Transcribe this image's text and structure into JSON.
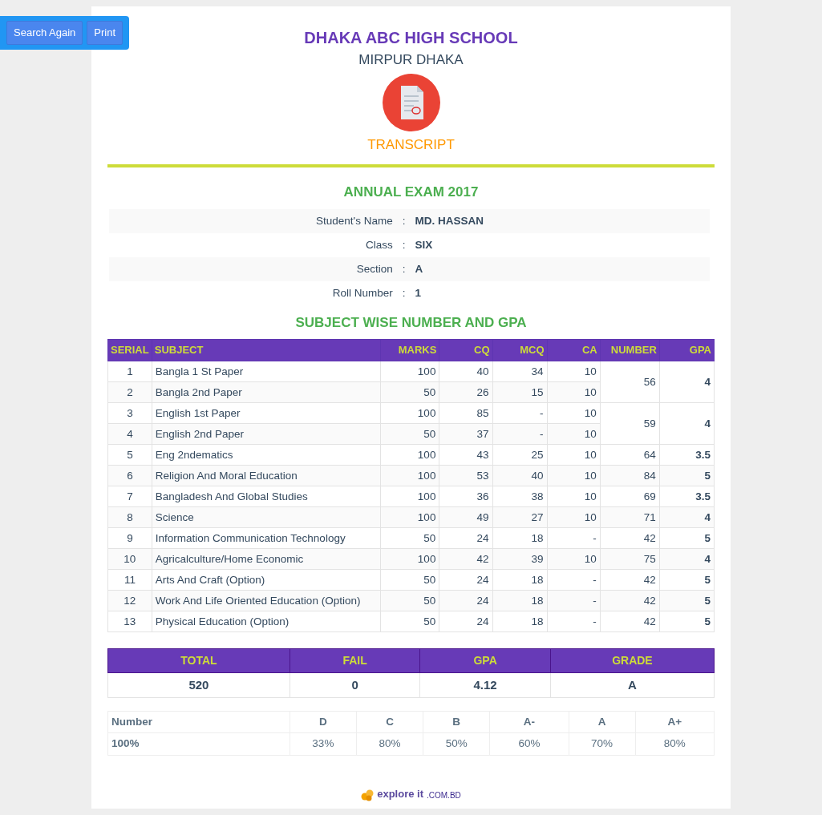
{
  "toolbar": {
    "buttons": [
      "Search Again",
      "Print"
    ]
  },
  "header": {
    "school": "DHAKA ABC HIGH SCHOOL",
    "location": "MIRPUR DHAKA",
    "document": "TRANSCRIPT"
  },
  "exam": {
    "title": "ANNUAL EXAM 2017"
  },
  "student": [
    {
      "label": "Student's Name",
      "separator": ":",
      "value": "MD. HASSAN"
    },
    {
      "label": "Class",
      "separator": ":",
      "value": "SIX"
    },
    {
      "label": "Section",
      "separator": ":",
      "value": "A"
    },
    {
      "label": "Roll Number",
      "separator": ":",
      "value": "1"
    }
  ],
  "subjects_title": "SUBJECT WISE NUMBER AND GPA",
  "subjects_table": {
    "columns": [
      "SERIAL",
      "SUBJECT",
      "MARKS",
      "CQ",
      "MCQ",
      "CA",
      "NUMBER",
      "GPA"
    ],
    "groups": [
      {
        "number": "56",
        "gpa": "4",
        "rows": [
          [
            "1",
            "Bangla 1 St Paper",
            "100",
            "40",
            "34",
            "10"
          ],
          [
            "2",
            "Bangla 2nd Paper",
            "50",
            "26",
            "15",
            "10"
          ]
        ]
      },
      {
        "number": "59",
        "gpa": "4",
        "rows": [
          [
            "3",
            "English 1st Paper",
            "100",
            "85",
            "-",
            "10"
          ],
          [
            "4",
            "English 2nd Paper",
            "50",
            "37",
            "-",
            "10"
          ]
        ]
      },
      {
        "number": "64",
        "gpa": "3.5",
        "rows": [
          [
            "5",
            "Eng 2ndematics",
            "100",
            "43",
            "25",
            "10"
          ]
        ]
      },
      {
        "number": "84",
        "gpa": "5",
        "rows": [
          [
            "6",
            "Religion And Moral Education",
            "100",
            "53",
            "40",
            "10"
          ]
        ]
      },
      {
        "number": "69",
        "gpa": "3.5",
        "rows": [
          [
            "7",
            "Bangladesh And Global Studies",
            "100",
            "36",
            "38",
            "10"
          ]
        ]
      },
      {
        "number": "71",
        "gpa": "4",
        "rows": [
          [
            "8",
            "Science",
            "100",
            "49",
            "27",
            "10"
          ]
        ]
      },
      {
        "number": "42",
        "gpa": "5",
        "rows": [
          [
            "9",
            "Information Communication Technology",
            "50",
            "24",
            "18",
            "-"
          ]
        ]
      },
      {
        "number": "75",
        "gpa": "4",
        "rows": [
          [
            "10",
            "Agricalculture/Home Economic",
            "100",
            "42",
            "39",
            "10"
          ]
        ]
      },
      {
        "number": "42",
        "gpa": "5",
        "rows": [
          [
            "11",
            "Arts And Craft (Option)",
            "50",
            "24",
            "18",
            "-"
          ]
        ]
      },
      {
        "number": "42",
        "gpa": "5",
        "rows": [
          [
            "12",
            "Work And Life Oriented Education (Option)",
            "50",
            "24",
            "18",
            "-"
          ]
        ]
      },
      {
        "number": "42",
        "gpa": "5",
        "rows": [
          [
            "13",
            "Physical Education (Option)",
            "50",
            "24",
            "18",
            "-"
          ]
        ]
      }
    ]
  },
  "summary_table": {
    "columns": [
      "TOTAL",
      "FAIL",
      "GPA",
      "GRADE"
    ],
    "values": [
      "520",
      "0",
      "4.12",
      "A"
    ]
  },
  "grade_scale": {
    "header": [
      "Number",
      "D",
      "C",
      "B",
      "A-",
      "A",
      "A+"
    ],
    "values": [
      "100%",
      "33%",
      "80%",
      "50%",
      "60%",
      "70%",
      "80%"
    ]
  },
  "footer": {
    "brand": "explore it",
    "domain": ".COM.BD"
  }
}
